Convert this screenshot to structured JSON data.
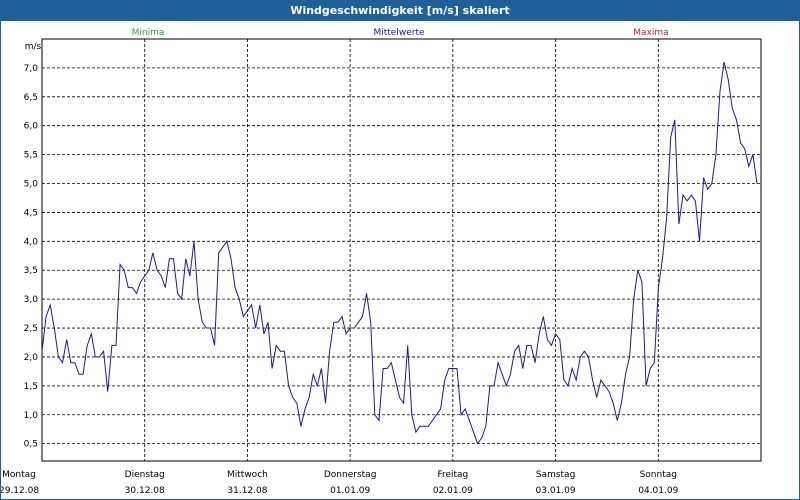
{
  "window": {
    "title": "Windgeschwindigkeit [m/s] skaliert"
  },
  "legend": [
    {
      "name": "Minima",
      "color": "#2aa02a"
    },
    {
      "name": "Mittelwerte",
      "color": "#1a1aa0"
    },
    {
      "name": "Maxima",
      "color": "#c0202a"
    }
  ],
  "chart_data": {
    "type": "line",
    "title": "Windgeschwindigkeit [m/s] skaliert",
    "ylabel": "m/s",
    "xlabel": "",
    "ylim": [
      0.2,
      7.5
    ],
    "yticks": [
      "0,5",
      "1,0",
      "1,5",
      "2,0",
      "2,5",
      "3,0",
      "3,5",
      "4,0",
      "4,5",
      "5,0",
      "5,5",
      "6,0",
      "6,5",
      "7,0"
    ],
    "ytick_values": [
      0.5,
      1.0,
      1.5,
      2.0,
      2.5,
      3.0,
      3.5,
      4.0,
      4.5,
      5.0,
      5.5,
      6.0,
      6.5,
      7.0
    ],
    "days": [
      {
        "weekday": "Montag",
        "date": "29.12.08"
      },
      {
        "weekday": "Dienstag",
        "date": "30.12.08"
      },
      {
        "weekday": "Mittwoch",
        "date": "31.12.08"
      },
      {
        "weekday": "Donnerstag",
        "date": "01.01.09"
      },
      {
        "weekday": "Freitag",
        "date": "02.01.09"
      },
      {
        "weekday": "Samstag",
        "date": "03.01.09"
      },
      {
        "weekday": "Sonntag",
        "date": "04.01.09"
      }
    ],
    "grid": true,
    "line_color": "#1a1aa0",
    "series": [
      {
        "values": [
          2.1,
          2.7,
          2.9,
          2.5,
          2.0,
          1.9,
          2.3,
          1.9,
          1.9,
          1.7,
          1.7,
          2.2,
          2.4,
          2.0,
          2.0,
          2.1,
          1.4,
          2.2,
          2.2,
          3.6,
          3.5,
          3.2,
          3.2,
          3.1,
          3.3,
          3.4,
          3.5,
          3.8,
          3.5,
          3.4,
          3.2,
          3.7,
          3.7,
          3.1,
          3.0,
          3.7,
          3.4,
          4.0,
          3.0,
          2.6,
          2.5,
          2.5,
          2.2,
          3.8,
          3.9,
          4.0,
          3.7,
          3.2,
          3.0,
          2.7,
          2.8,
          2.9,
          2.5,
          2.9,
          2.4,
          2.6,
          1.8,
          2.2,
          2.1,
          2.1,
          1.5,
          1.3,
          1.2,
          0.8,
          1.1,
          1.3,
          1.7,
          1.5,
          1.8,
          1.2,
          2.1,
          2.6,
          2.6,
          2.7,
          2.4,
          2.5,
          2.5,
          2.6,
          2.7,
          3.1,
          2.6,
          1.0,
          0.9,
          1.8,
          1.8,
          1.9,
          1.6,
          1.3,
          1.2,
          2.2,
          1.0,
          0.7,
          0.8,
          0.8,
          0.8,
          0.9,
          1.0,
          1.1,
          1.6,
          1.8,
          1.8,
          1.8,
          1.0,
          1.1,
          0.9,
          0.7,
          0.5,
          0.6,
          0.8,
          1.5,
          1.5,
          1.9,
          1.7,
          1.5,
          1.7,
          2.1,
          2.2,
          1.8,
          2.2,
          2.2,
          1.9,
          2.4,
          2.7,
          2.3,
          2.2,
          2.4,
          2.3,
          1.6,
          1.5,
          1.8,
          1.6,
          2.0,
          2.1,
          2.0,
          1.6,
          1.3,
          1.6,
          1.5,
          1.4,
          1.2,
          0.9,
          1.2,
          1.7,
          2.0,
          3.0,
          3.5,
          3.3,
          1.5,
          1.8,
          1.9,
          3.2,
          3.7,
          4.4,
          5.8,
          6.1,
          4.3,
          4.8,
          4.7,
          4.8,
          4.7,
          4.0,
          5.1,
          4.9,
          5.0,
          5.5,
          6.6,
          7.1,
          6.8,
          6.3,
          6.1,
          5.7,
          5.6,
          5.3,
          5.5,
          5.0
        ]
      }
    ]
  }
}
